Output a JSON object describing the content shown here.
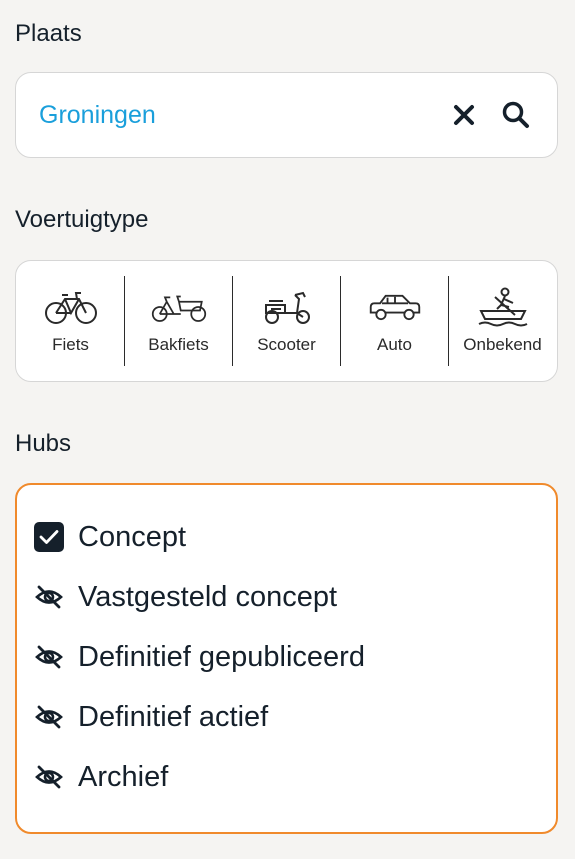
{
  "place": {
    "label": "Plaats",
    "search": {
      "value": "Groningen",
      "clear_icon": "close-icon",
      "search_icon": "search-icon"
    }
  },
  "vehicle_type": {
    "label": "Voertuigtype",
    "items": [
      {
        "label": "Fiets",
        "icon": "bicycle-icon"
      },
      {
        "label": "Bakfiets",
        "icon": "cargo-bike-icon"
      },
      {
        "label": "Scooter",
        "icon": "scooter-icon"
      },
      {
        "label": "Auto",
        "icon": "car-icon"
      },
      {
        "label": "Onbekend",
        "icon": "boat-icon"
      }
    ]
  },
  "hubs": {
    "label": "Hubs",
    "accent_color": "#f08a2c",
    "items": [
      {
        "label": "Concept",
        "state": "checked"
      },
      {
        "label": "Vastgesteld concept",
        "state": "hidden"
      },
      {
        "label": "Definitief gepubliceerd",
        "state": "hidden"
      },
      {
        "label": "Definitief actief",
        "state": "hidden"
      },
      {
        "label": "Archief",
        "state": "hidden"
      }
    ]
  },
  "colors": {
    "search_value": "#1a9fdb",
    "text": "#15202b",
    "background": "#f5f4f2"
  }
}
